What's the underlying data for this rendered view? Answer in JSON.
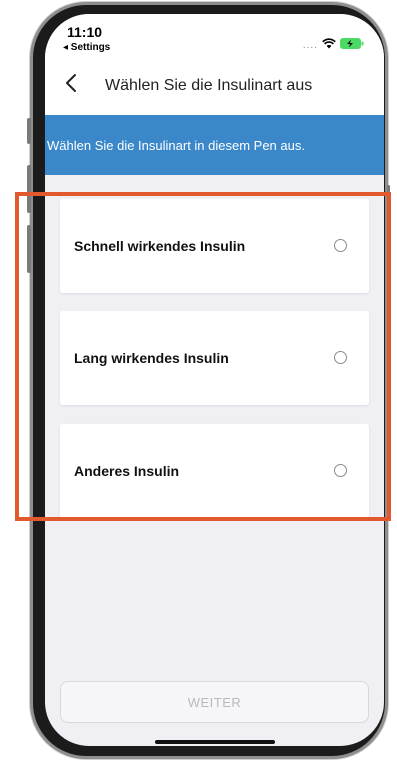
{
  "status_bar": {
    "time": "11:10",
    "back_app": "◂ Settings",
    "signal_dots": "....",
    "wifi_icon": "wifi-icon",
    "battery_icon": "battery-charging-icon"
  },
  "nav": {
    "back_icon": "chevron-left-icon",
    "back_glyph": "‹",
    "title": "Wählen Sie die Insulinart aus"
  },
  "banner": {
    "text": "Wählen Sie die Insulinart in diesem Pen aus."
  },
  "options": [
    {
      "label": "Schnell wirkendes Insulin",
      "selected": false
    },
    {
      "label": "Lang wirkendes Insulin",
      "selected": false
    },
    {
      "label": "Anderes Insulin",
      "selected": false
    }
  ],
  "footer": {
    "continue_label": "WEITER",
    "enabled": false
  },
  "colors": {
    "banner": "#3a87c9",
    "highlight_frame": "#e2592d",
    "background": "#efeff4"
  }
}
